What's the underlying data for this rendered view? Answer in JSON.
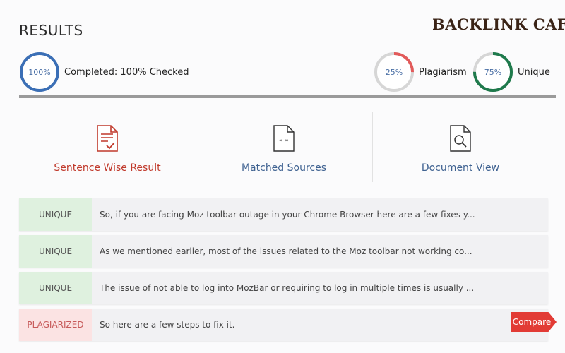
{
  "header": {
    "title": "RESULTS",
    "brand": "BACKLINK CAFE"
  },
  "stats": {
    "completed": {
      "value_label": "100%",
      "label": "Completed: 100% Checked",
      "fraction": 1.0,
      "color": "#3b6fb6"
    },
    "plagiarism": {
      "value_label": "25%",
      "label": "Plagiarism",
      "fraction": 0.25,
      "color": "#e25a5a"
    },
    "unique": {
      "value_label": "75%",
      "label": "Unique",
      "fraction": 0.75,
      "color": "#1f7a4c"
    }
  },
  "tabs": [
    {
      "label": "Sentence Wise Result",
      "icon": "document-check-icon",
      "color": "#c0392b"
    },
    {
      "label": "Matched Sources",
      "icon": "document-link-icon",
      "color": "#3f6291"
    },
    {
      "label": "Document View",
      "icon": "document-search-icon",
      "color": "#3f6291"
    }
  ],
  "results": [
    {
      "status": "UNIQUE",
      "text": "So, if you are facing Moz toolbar outage in your Chrome Browser here are a few fixes y..."
    },
    {
      "status": "UNIQUE",
      "text": "As we mentioned earlier, most of the issues related to the Moz toolbar not working co..."
    },
    {
      "status": "UNIQUE",
      "text": "The issue of not able to log into MozBar or requiring to log in multiple times is usually ..."
    },
    {
      "status": "PLAGIARIZED",
      "text": "So here are a few steps to fix it.",
      "action": "Compare"
    }
  ],
  "colors": {
    "unique_bg": "#dff1df",
    "plagiarized_bg": "#fbe3e3",
    "compare_button": "#e23b35"
  }
}
